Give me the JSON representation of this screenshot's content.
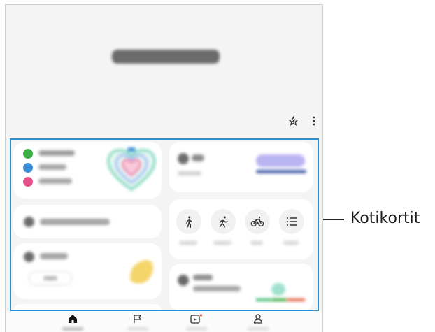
{
  "callout": {
    "label": "Kotikortit"
  },
  "colors": {
    "frame": "#2b8fcc",
    "green": "#3fae49",
    "blue": "#3b8ed6",
    "pink": "#e8508c",
    "lavender": "#b9b4f2",
    "navy": "#4d63b0",
    "yellow": "#f4d56a",
    "teal": "#9fe0cf",
    "bar_green": "#4cbf7d",
    "bar_red": "#e5684a"
  },
  "header": {
    "icons": [
      "add-favorite-icon",
      "more-options-icon"
    ]
  },
  "exercise_icons": [
    "walking-icon",
    "running-icon",
    "cycling-icon",
    "list-icon"
  ],
  "nav": {
    "icons": [
      "home-icon",
      "flag-icon",
      "together-icon",
      "profile-icon"
    ]
  }
}
